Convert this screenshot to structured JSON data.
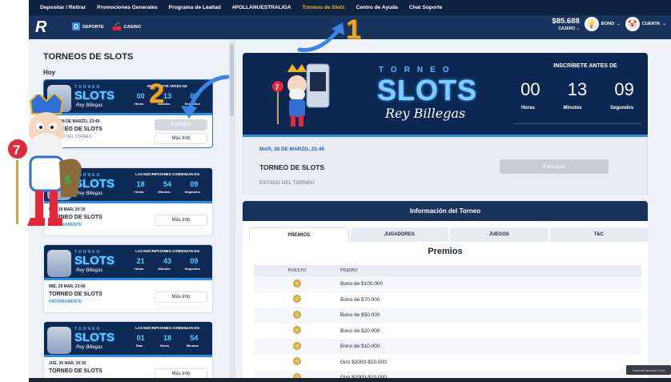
{
  "nav": {
    "links": [
      "Depositar / Retirar",
      "Promociones Generales",
      "Programa de Lealtad",
      "#POLLANUESTRALIGA",
      "Torneos de Slots",
      "Centro de Ayuda",
      "Chat Soporte"
    ],
    "active_index": 4
  },
  "header": {
    "logo_text": "R",
    "deporte": "DEPORTE",
    "casino": "CASINO",
    "balance": "$85.688",
    "cajero": "CAJERO",
    "bono": "BONO",
    "cuenta": "CUENTA"
  },
  "left": {
    "title": "TORNEOS DE SLOTS",
    "today_label": "Hoy",
    "tomorrow_label": "Mañana",
    "cards": [
      {
        "banner_label": "INSCRÍBETE ANTES DE",
        "counts": [
          "00",
          "13",
          "09"
        ],
        "units": [
          "Horas",
          "Minutos",
          "Segundos"
        ],
        "date": "MAR, 28 DE MARZO, 23:49",
        "name": "TORNEO DE SLOTS",
        "status": "ESTADO DEL TORNEO",
        "btn_participar": "Participar",
        "btn_info": "Más Info"
      },
      {
        "banner_label": "LAS INSCRIPCIONES COMIENZAN EN",
        "counts": [
          "18",
          "54",
          "09"
        ],
        "units": [
          "Horas",
          "Minutos",
          "Segundos"
        ],
        "date": "MIÉ, 29 MAR, 20:30",
        "name": "TORNEO DE SLOTS",
        "status": "PRÓXIMAMENTE",
        "btn_info": "Más Info"
      },
      {
        "banner_label": "LAS INSCRIPCIONES COMIENZAN EN",
        "counts": [
          "21",
          "43",
          "09"
        ],
        "units": [
          "Horas",
          "Minutos",
          "Segundos"
        ],
        "date": "MIÉ, 29 MAR, 23:49",
        "name": "TORNEO DE SLOTS",
        "status": "PRÓXIMAMENTE",
        "btn_info": "Más Info"
      },
      {
        "banner_label": "LAS INSCRIPCIONES COMIENZAN EN",
        "counts": [
          "01",
          "18",
          "54"
        ],
        "units": [
          "Días",
          "Horas",
          "Minutos"
        ],
        "date": "JUE, 30 MAR, 20:30",
        "name": "TORNEO DE SLOTS",
        "btn_info": "Más Info"
      }
    ],
    "banner_title": "TORNEO",
    "banner_slots": "SLOTS",
    "banner_rey": "Rey Billegas"
  },
  "hero": {
    "torneo": "TORNEO",
    "slots": "SLOTS",
    "rey": "Rey Billegas",
    "ins_label": "INSCRÍBETE ANTES DE",
    "counts": [
      "00",
      "13",
      "09"
    ],
    "units": [
      "Horas",
      "Minutos",
      "Segundos"
    ],
    "date": "MAR, 28 DE MARZO, 23:49",
    "name": "TORNEO DE SLOTS",
    "status": "ESTADO DEL TORNEO",
    "participar": "Participar"
  },
  "info": {
    "header": "Información del Torneo",
    "tabs": [
      "PREMIOS",
      "JUGADORES",
      "JUEGOS",
      "T&C"
    ],
    "active_tab": 0,
    "premios_title": "Premios",
    "col_puesto": "PUESTO",
    "col_premio": "PREMIO",
    "premios": [
      "Bono de $100.000",
      "Bono de $70.000",
      "Bono de $50.000",
      "Bono de $20.000",
      "Bono de $10.000",
      "Giro $2000-$10.000",
      "Giro $2000-$10.000"
    ]
  },
  "overlays": {
    "num1": "1",
    "num2": "2"
  },
  "tooltip": "Hora del servidor: 9:31",
  "colors": {
    "navy": "#0e2341",
    "accent": "#f2b51c",
    "blue": "#2a8fe0"
  }
}
